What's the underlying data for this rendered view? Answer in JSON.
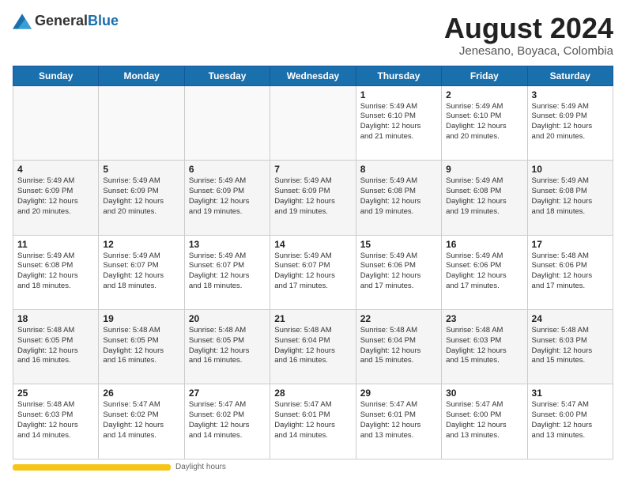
{
  "header": {
    "logo_general": "General",
    "logo_blue": "Blue",
    "month_year": "August 2024",
    "location": "Jenesano, Boyaca, Colombia"
  },
  "weekdays": [
    "Sunday",
    "Monday",
    "Tuesday",
    "Wednesday",
    "Thursday",
    "Friday",
    "Saturday"
  ],
  "weeks": [
    [
      {
        "day": "",
        "info": ""
      },
      {
        "day": "",
        "info": ""
      },
      {
        "day": "",
        "info": ""
      },
      {
        "day": "",
        "info": ""
      },
      {
        "day": "1",
        "info": "Sunrise: 5:49 AM\nSunset: 6:10 PM\nDaylight: 12 hours\nand 21 minutes."
      },
      {
        "day": "2",
        "info": "Sunrise: 5:49 AM\nSunset: 6:10 PM\nDaylight: 12 hours\nand 20 minutes."
      },
      {
        "day": "3",
        "info": "Sunrise: 5:49 AM\nSunset: 6:09 PM\nDaylight: 12 hours\nand 20 minutes."
      }
    ],
    [
      {
        "day": "4",
        "info": "Sunrise: 5:49 AM\nSunset: 6:09 PM\nDaylight: 12 hours\nand 20 minutes."
      },
      {
        "day": "5",
        "info": "Sunrise: 5:49 AM\nSunset: 6:09 PM\nDaylight: 12 hours\nand 20 minutes."
      },
      {
        "day": "6",
        "info": "Sunrise: 5:49 AM\nSunset: 6:09 PM\nDaylight: 12 hours\nand 19 minutes."
      },
      {
        "day": "7",
        "info": "Sunrise: 5:49 AM\nSunset: 6:09 PM\nDaylight: 12 hours\nand 19 minutes."
      },
      {
        "day": "8",
        "info": "Sunrise: 5:49 AM\nSunset: 6:08 PM\nDaylight: 12 hours\nand 19 minutes."
      },
      {
        "day": "9",
        "info": "Sunrise: 5:49 AM\nSunset: 6:08 PM\nDaylight: 12 hours\nand 19 minutes."
      },
      {
        "day": "10",
        "info": "Sunrise: 5:49 AM\nSunset: 6:08 PM\nDaylight: 12 hours\nand 18 minutes."
      }
    ],
    [
      {
        "day": "11",
        "info": "Sunrise: 5:49 AM\nSunset: 6:08 PM\nDaylight: 12 hours\nand 18 minutes."
      },
      {
        "day": "12",
        "info": "Sunrise: 5:49 AM\nSunset: 6:07 PM\nDaylight: 12 hours\nand 18 minutes."
      },
      {
        "day": "13",
        "info": "Sunrise: 5:49 AM\nSunset: 6:07 PM\nDaylight: 12 hours\nand 18 minutes."
      },
      {
        "day": "14",
        "info": "Sunrise: 5:49 AM\nSunset: 6:07 PM\nDaylight: 12 hours\nand 17 minutes."
      },
      {
        "day": "15",
        "info": "Sunrise: 5:49 AM\nSunset: 6:06 PM\nDaylight: 12 hours\nand 17 minutes."
      },
      {
        "day": "16",
        "info": "Sunrise: 5:49 AM\nSunset: 6:06 PM\nDaylight: 12 hours\nand 17 minutes."
      },
      {
        "day": "17",
        "info": "Sunrise: 5:48 AM\nSunset: 6:06 PM\nDaylight: 12 hours\nand 17 minutes."
      }
    ],
    [
      {
        "day": "18",
        "info": "Sunrise: 5:48 AM\nSunset: 6:05 PM\nDaylight: 12 hours\nand 16 minutes."
      },
      {
        "day": "19",
        "info": "Sunrise: 5:48 AM\nSunset: 6:05 PM\nDaylight: 12 hours\nand 16 minutes."
      },
      {
        "day": "20",
        "info": "Sunrise: 5:48 AM\nSunset: 6:05 PM\nDaylight: 12 hours\nand 16 minutes."
      },
      {
        "day": "21",
        "info": "Sunrise: 5:48 AM\nSunset: 6:04 PM\nDaylight: 12 hours\nand 16 minutes."
      },
      {
        "day": "22",
        "info": "Sunrise: 5:48 AM\nSunset: 6:04 PM\nDaylight: 12 hours\nand 15 minutes."
      },
      {
        "day": "23",
        "info": "Sunrise: 5:48 AM\nSunset: 6:03 PM\nDaylight: 12 hours\nand 15 minutes."
      },
      {
        "day": "24",
        "info": "Sunrise: 5:48 AM\nSunset: 6:03 PM\nDaylight: 12 hours\nand 15 minutes."
      }
    ],
    [
      {
        "day": "25",
        "info": "Sunrise: 5:48 AM\nSunset: 6:03 PM\nDaylight: 12 hours\nand 14 minutes."
      },
      {
        "day": "26",
        "info": "Sunrise: 5:47 AM\nSunset: 6:02 PM\nDaylight: 12 hours\nand 14 minutes."
      },
      {
        "day": "27",
        "info": "Sunrise: 5:47 AM\nSunset: 6:02 PM\nDaylight: 12 hours\nand 14 minutes."
      },
      {
        "day": "28",
        "info": "Sunrise: 5:47 AM\nSunset: 6:01 PM\nDaylight: 12 hours\nand 14 minutes."
      },
      {
        "day": "29",
        "info": "Sunrise: 5:47 AM\nSunset: 6:01 PM\nDaylight: 12 hours\nand 13 minutes."
      },
      {
        "day": "30",
        "info": "Sunrise: 5:47 AM\nSunset: 6:00 PM\nDaylight: 12 hours\nand 13 minutes."
      },
      {
        "day": "31",
        "info": "Sunrise: 5:47 AM\nSunset: 6:00 PM\nDaylight: 12 hours\nand 13 minutes."
      }
    ]
  ],
  "footer": {
    "daylight_label": "Daylight hours"
  }
}
